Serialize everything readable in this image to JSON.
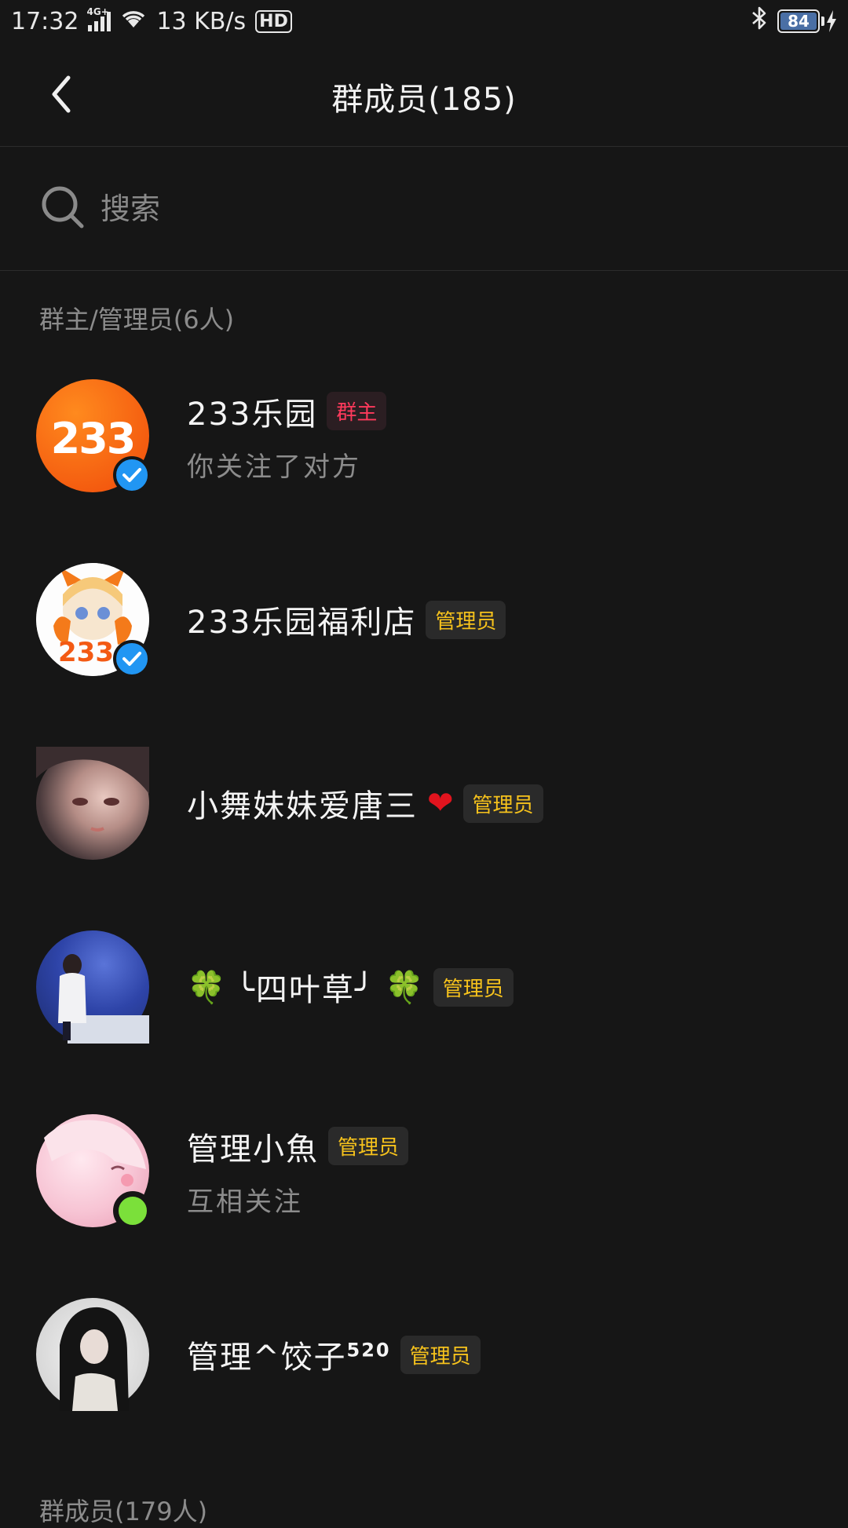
{
  "status": {
    "time": "17:32",
    "network": "4G+",
    "speed": "13 KB/s",
    "hd": "HD",
    "battery": "84"
  },
  "nav": {
    "title": "群成员(185)"
  },
  "search": {
    "placeholder": "搜索"
  },
  "sections": {
    "admins_header": "群主/管理员(6人)",
    "members_header": "群成员(179人)"
  },
  "members": [
    {
      "name": "233乐园",
      "badge": "群主",
      "sub": "你关注了对方",
      "avatar_text": "233"
    },
    {
      "name": "233乐园福利店",
      "badge": "管理员",
      "sub": "",
      "avatar_text": "233"
    },
    {
      "name": "小舞妹妹爱唐三",
      "badge": "管理员",
      "sub": "",
      "suffix": "❤"
    },
    {
      "name": "╰四叶草╯",
      "badge": "管理员",
      "sub": "",
      "prefix": "🍀",
      "suffix": "🍀"
    },
    {
      "name": "管理小魚",
      "badge": "管理员",
      "sub": "互相关注"
    },
    {
      "name": "管理^饺子",
      "badge": "管理员",
      "sub": "",
      "sup": "520"
    }
  ],
  "colors": {
    "background": "#161616",
    "owner_badge": "#ff3a5c",
    "admin_badge": "#f6c21c",
    "verified": "#2196f3",
    "online": "#7be03a"
  }
}
